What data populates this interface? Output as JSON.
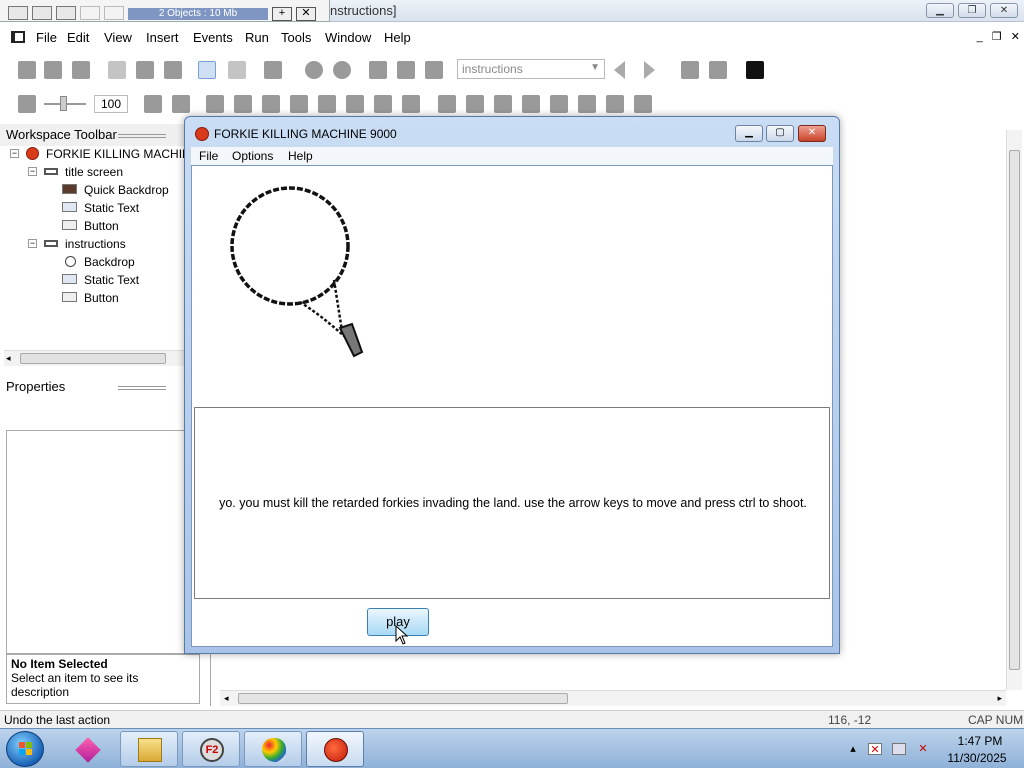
{
  "app": {
    "title_fragment": "nstructions]",
    "mini_toolbar_status": "2 Objects : 10 Mb"
  },
  "menubar": {
    "items": [
      "File",
      "Edit",
      "View",
      "Insert",
      "Events",
      "Run",
      "Tools",
      "Window",
      "Help"
    ],
    "mdi_controls": [
      "_",
      "❐",
      "✕"
    ]
  },
  "toolbar": {
    "layout_selector_value": "instructions",
    "zoom_value": "100"
  },
  "workspace": {
    "header": "Workspace Toolbar",
    "tree": {
      "root": "FORKIE KILLING MACHINE",
      "frames": [
        {
          "label": "title screen",
          "children": [
            "Quick Backdrop",
            "Static Text",
            "Button"
          ]
        },
        {
          "label": "instructions",
          "children": [
            "Backdrop",
            "Static Text",
            "Button"
          ]
        }
      ]
    }
  },
  "properties": {
    "header": "Properties",
    "description_title": "No Item Selected",
    "description_text": "Select an item to see its description"
  },
  "run_window": {
    "title": "FORKIE KILLING MACHINE 9000",
    "menu": [
      "File",
      "Options",
      "Help"
    ],
    "instructions_text": "yo. you must kill the retarded forkies invading the land. use the arrow keys to move and press ctrl to shoot.",
    "play_button": "play"
  },
  "statusbar": {
    "text": "Undo the last action",
    "coords": "116, -12",
    "indicators": "CAP  NUM"
  },
  "taskbar": {
    "time": "1:47 PM",
    "date": "11/30/2025"
  },
  "colors": {
    "run_window_frame": "#a8c4e8",
    "play_button": "#a7d9f5",
    "taskbar": "#8fb1d8"
  }
}
